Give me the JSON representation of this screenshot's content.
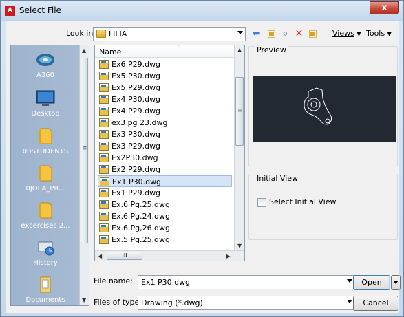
{
  "window": {
    "title": "Select File",
    "close_label": "x",
    "app_icon_label": "A"
  },
  "toolbar": {
    "look_in_label": "Look in:",
    "look_in_value": "LILIA",
    "views_label": "Views",
    "tools_label": "Tools",
    "icons": [
      "back-icon",
      "up-folder-icon",
      "search-web-icon",
      "delete-icon",
      "create-folder-icon",
      "views-dropdown-icon",
      "tools-dropdown-icon"
    ]
  },
  "places": {
    "items": [
      {
        "label": "A360",
        "icon": "a360-cloud-icon"
      },
      {
        "label": "Desktop",
        "icon": "desktop-icon"
      },
      {
        "label": "00STUDENTS",
        "icon": "folder-icon"
      },
      {
        "label": "0JOLA_PR...",
        "icon": "folder-icon"
      },
      {
        "label": "excercises 2...",
        "icon": "folder-icon"
      },
      {
        "label": "History",
        "icon": "history-icon"
      },
      {
        "label": "Documents",
        "icon": "documents-icon"
      }
    ]
  },
  "filelist": {
    "column_header": "Name",
    "files": [
      "Ex6 P29.dwg",
      "Ex5 P30.dwg",
      "Ex5 P29.dwg",
      "Ex4 P30.dwg",
      "Ex4 P29.dwg",
      "ex3 pg 23.dwg",
      "Ex3 P30.dwg",
      "Ex3 P29.dwg",
      "Ex2P30.dwg",
      "Ex2 P29.dwg",
      "Ex1 P30.dwg",
      "Ex1 P29.dwg",
      "Ex.6 Pg.25.dwg",
      "Ex.6 Pg.24.dwg",
      "Ex.6 Pg,26.dwg",
      "Ex.5 Pg.25.dwg"
    ],
    "selected": "Ex1 P30.dwg",
    "hscroll_thumb_label": "III"
  },
  "preview": {
    "label": "Preview"
  },
  "initial_view": {
    "label": "Initial View",
    "checkbox_label": "Select Initial View",
    "checked": false
  },
  "bottom": {
    "file_name_label": "File name:",
    "file_name_value": "Ex1 P30.dwg",
    "file_type_label": "Files of type:",
    "file_type_value": "Drawing (*.dwg)",
    "open_label": "Open",
    "cancel_label": "Cancel"
  },
  "colors": {
    "title_bar": "#c2d6eb",
    "close_button": "#c4493a",
    "places_bar": "#a2b6cf",
    "selection": "#d4e3f6",
    "preview_bg": "#222933"
  }
}
